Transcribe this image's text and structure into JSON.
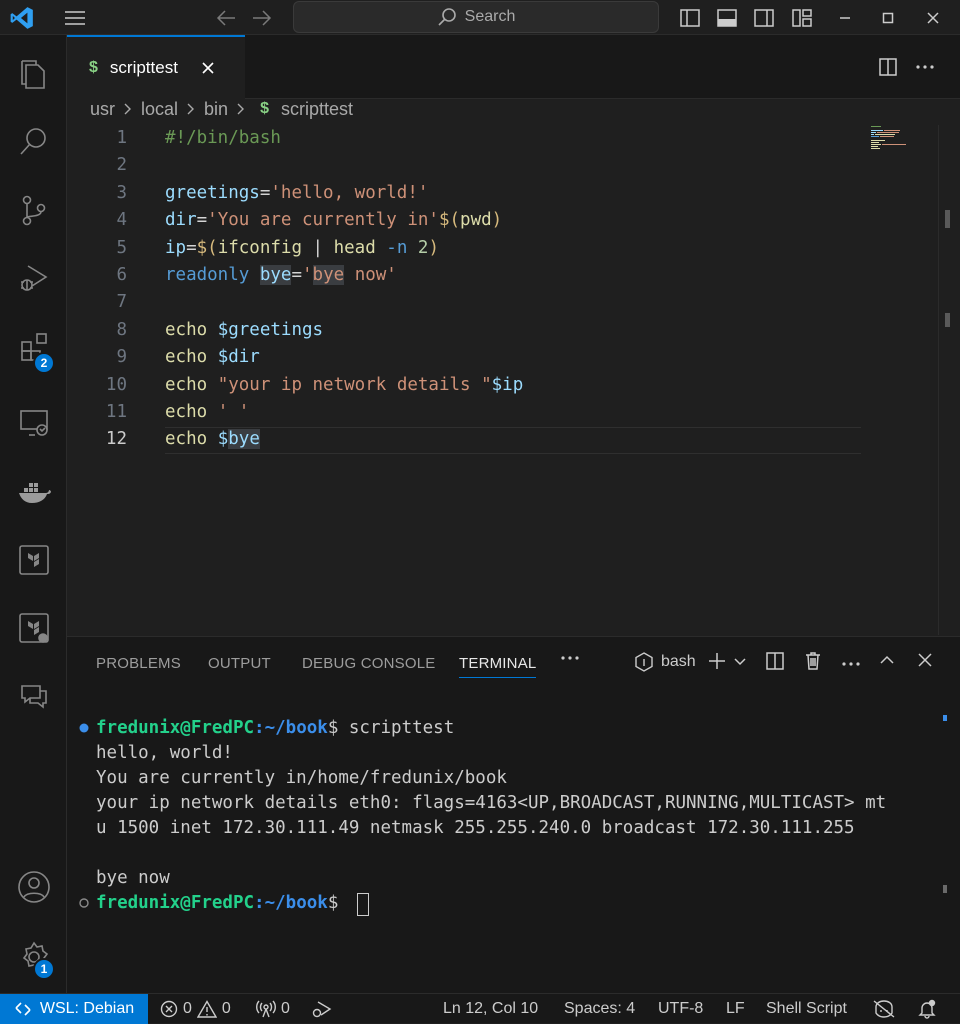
{
  "search": {
    "placeholder": "Search"
  },
  "tab": {
    "label": "scripttest",
    "icon": "$"
  },
  "breadcrumb": {
    "items": [
      "usr",
      "local",
      "bin",
      "scripttest"
    ],
    "file_icon": "$"
  },
  "activity_badges": {
    "extensions": "2",
    "settings": "1"
  },
  "editor": {
    "lines": [
      {
        "n": "1",
        "parts": [
          {
            "t": "#!/bin/bash",
            "c": "c-com"
          }
        ]
      },
      {
        "n": "2",
        "parts": []
      },
      {
        "n": "3",
        "parts": [
          {
            "t": "greetings",
            "c": "c-var"
          },
          {
            "t": "=",
            "c": "c-op"
          },
          {
            "t": "'hello, world!'",
            "c": "c-str"
          }
        ]
      },
      {
        "n": "4",
        "parts": [
          {
            "t": "dir",
            "c": "c-var"
          },
          {
            "t": "=",
            "c": "c-op"
          },
          {
            "t": "'You are currently in'",
            "c": "c-str"
          },
          {
            "t": "$(",
            "c": "c-dol"
          },
          {
            "t": "pwd",
            "c": "c-fn"
          },
          {
            "t": ")",
            "c": "c-dol"
          }
        ]
      },
      {
        "n": "5",
        "parts": [
          {
            "t": "ip",
            "c": "c-var"
          },
          {
            "t": "=",
            "c": "c-op"
          },
          {
            "t": "$(",
            "c": "c-dol"
          },
          {
            "t": "ifconfig",
            "c": "c-fn"
          },
          {
            "t": " | ",
            "c": "c-op"
          },
          {
            "t": "head",
            "c": "c-fn"
          },
          {
            "t": " -n ",
            "c": "c-kw"
          },
          {
            "t": "2",
            "c": "c-num"
          },
          {
            "t": ")",
            "c": "c-dol"
          }
        ]
      },
      {
        "n": "6",
        "parts": [
          {
            "t": "readonly",
            "c": "c-kw"
          },
          {
            "t": " ",
            "c": "c-op"
          },
          {
            "t": "bye",
            "c": "c-var hl"
          },
          {
            "t": "=",
            "c": "c-op"
          },
          {
            "t": "'",
            "c": "c-str"
          },
          {
            "t": "bye",
            "c": "c-str hl"
          },
          {
            "t": " now'",
            "c": "c-str"
          }
        ]
      },
      {
        "n": "7",
        "parts": []
      },
      {
        "n": "8",
        "parts": [
          {
            "t": "echo",
            "c": "c-fn"
          },
          {
            "t": " ",
            "c": "c-op"
          },
          {
            "t": "$greetings",
            "c": "c-var"
          }
        ]
      },
      {
        "n": "9",
        "parts": [
          {
            "t": "echo",
            "c": "c-fn"
          },
          {
            "t": " ",
            "c": "c-op"
          },
          {
            "t": "$dir",
            "c": "c-var"
          }
        ]
      },
      {
        "n": "10",
        "parts": [
          {
            "t": "echo",
            "c": "c-fn"
          },
          {
            "t": " ",
            "c": "c-op"
          },
          {
            "t": "\"your ip network details \"",
            "c": "c-str"
          },
          {
            "t": "$ip",
            "c": "c-var"
          }
        ]
      },
      {
        "n": "11",
        "parts": [
          {
            "t": "echo",
            "c": "c-fn"
          },
          {
            "t": " ",
            "c": "c-op"
          },
          {
            "t": "' '",
            "c": "c-str"
          }
        ]
      },
      {
        "n": "12",
        "parts": [
          {
            "t": "echo",
            "c": "c-fn"
          },
          {
            "t": " ",
            "c": "c-op"
          },
          {
            "t": "$",
            "c": "c-var"
          },
          {
            "t": "bye",
            "c": "c-var hl"
          }
        ]
      }
    ],
    "current_line": "12"
  },
  "panel": {
    "tabs": [
      "PROBLEMS",
      "OUTPUT",
      "DEBUG CONSOLE",
      "TERMINAL"
    ],
    "active_tab": "TERMINAL",
    "shell": "bash"
  },
  "terminal": {
    "prompt_user": "fredunix@FredPC",
    "prompt_path": ":~/book",
    "prompt_end": "$ ",
    "command": "scripttest",
    "output": [
      "hello, world!",
      "You are currently in/home/fredunix/book",
      "your ip network details eth0: flags=4163<UP,BROADCAST,RUNNING,MULTICAST> mt",
      "u 1500 inet 172.30.111.49 netmask 255.255.240.0 broadcast 172.30.111.255",
      "",
      "bye now"
    ]
  },
  "statusbar": {
    "remote": "WSL: Debian",
    "errors": "0",
    "warnings": "0",
    "ports": "0",
    "position": "Ln 12, Col 10",
    "spaces": "Spaces: 4",
    "encoding": "UTF-8",
    "eol": "LF",
    "language": "Shell Script"
  },
  "colors": {
    "accent": "#0078d4",
    "prompt_user": "#23d18b",
    "prompt_path": "#3b8eea"
  }
}
